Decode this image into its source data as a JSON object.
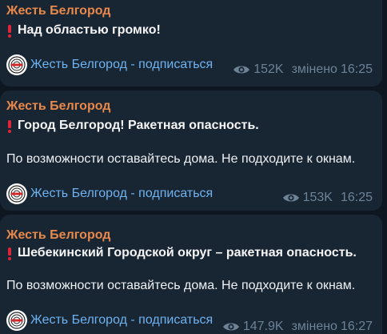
{
  "messages": [
    {
      "author": "Жесть Белгород",
      "headline": "Над областью громко!",
      "body": "",
      "link": "Жесть Белгород - подписаться",
      "views": "152K",
      "edited": "змінено",
      "time": "16:25"
    },
    {
      "author": "Жесть Белгород",
      "headline": "Город Белгород! Ракетная опасность.",
      "body": "По возможности оставайтесь дома. Не подходите к окнам.",
      "link": "Жесть Белгород - подписаться",
      "views": "153K",
      "edited": "",
      "time": "16:25"
    },
    {
      "author": "Жесть Белгород",
      "headline": "Шебекинский Городской округ – ракетная опасность.",
      "body": "По возможности оставайтесь дома. Не подходите к окнам.",
      "link": "Жесть Белгород - подписаться",
      "views": "147.9K",
      "edited": "змінено",
      "time": "16:27"
    }
  ],
  "colors": {
    "background": "#0e1621",
    "bubble": "#182533",
    "author": "#e8884a",
    "link": "#6fb3f0",
    "meta": "#6d8396",
    "exclamation": "#e0243a"
  },
  "icons": {
    "headline_prefix": "exclamation-icon",
    "views": "eye-icon",
    "avatar": "channel-logo-icon"
  }
}
